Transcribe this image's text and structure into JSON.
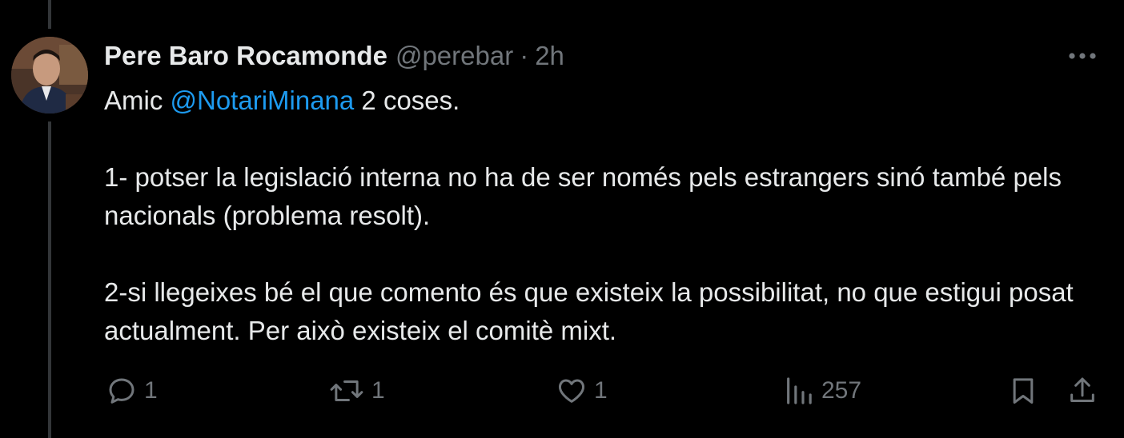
{
  "author": {
    "display_name": "Pere Baro Rocamonde",
    "handle": "@perebar",
    "separator": "·",
    "time": "2h"
  },
  "tweet": {
    "prefix": "Amic ",
    "mention": "@NotariMinana",
    "suffix": " 2 coses.",
    "line2": "1- potser la legislació interna no ha de ser només pels estrangers sinó també pels nacionals (problema resolt).",
    "line3": "2-si llegeixes bé el que comento és que existeix la possibilitat, no que estigui posat actualment. Per això existeix el comitè mixt."
  },
  "actions": {
    "replies": "1",
    "reposts": "1",
    "likes": "1",
    "views": "257"
  },
  "icons": {
    "reply": "reply-icon",
    "repost": "repost-icon",
    "like": "heart-icon",
    "views": "views-icon",
    "bookmark": "bookmark-icon",
    "share": "share-icon",
    "more": "more-icon"
  },
  "colors": {
    "background": "#000000",
    "text": "#e7e9ea",
    "muted": "#71767b",
    "link": "#1d9bf0",
    "thread_line": "#333639"
  }
}
